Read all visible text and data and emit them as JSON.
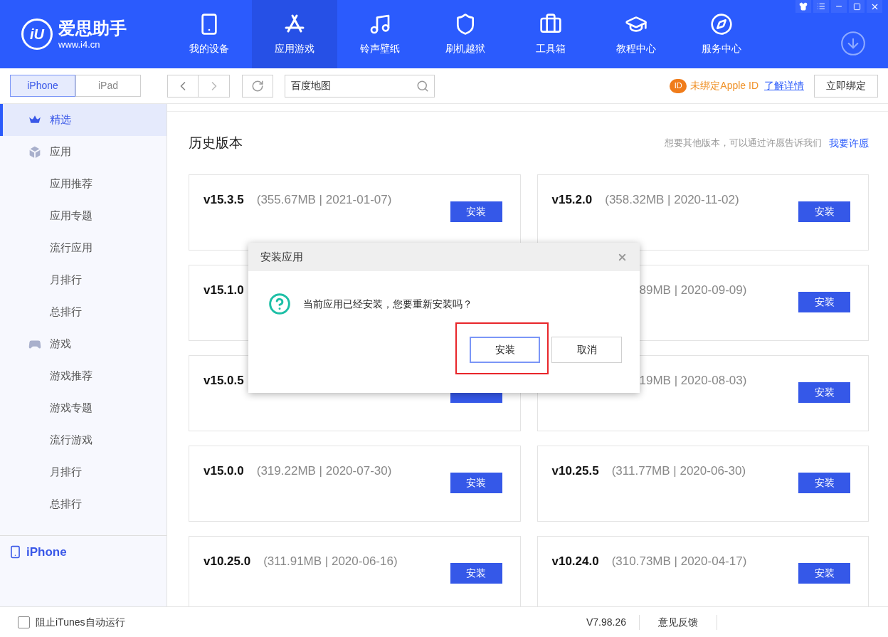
{
  "app": {
    "name": "爱思助手",
    "url": "www.i4.cn",
    "mark": "iU"
  },
  "nav": [
    {
      "label": "我的设备",
      "selected": false
    },
    {
      "label": "应用游戏",
      "selected": true
    },
    {
      "label": "铃声壁纸",
      "selected": false
    },
    {
      "label": "刷机越狱",
      "selected": false
    },
    {
      "label": "工具箱",
      "selected": false
    },
    {
      "label": "教程中心",
      "selected": false
    },
    {
      "label": "服务中心",
      "selected": false
    }
  ],
  "device_tabs": [
    {
      "label": "iPhone",
      "selected": true
    },
    {
      "label": "iPad",
      "selected": false
    }
  ],
  "search": {
    "value": "百度地图"
  },
  "apple_id": {
    "badge": "ID",
    "notice": "未绑定Apple ID",
    "link": "了解详情",
    "button": "立即绑定"
  },
  "sidebar": {
    "items": [
      {
        "label": "精选",
        "selected": true
      },
      {
        "label": "应用",
        "selected": false,
        "children": [
          {
            "label": "应用推荐",
            "selected": false
          },
          {
            "label": "应用专题",
            "selected": false
          },
          {
            "label": "流行应用",
            "selected": false
          },
          {
            "label": "月排行",
            "selected": false
          },
          {
            "label": "总排行",
            "selected": false
          }
        ]
      },
      {
        "label": "游戏",
        "selected": false,
        "children": [
          {
            "label": "游戏推荐",
            "selected": false
          },
          {
            "label": "游戏专题",
            "selected": false
          },
          {
            "label": "流行游戏",
            "selected": false
          },
          {
            "label": "月排行",
            "selected": false
          },
          {
            "label": "总排行",
            "selected": false
          }
        ]
      }
    ],
    "device": "iPhone"
  },
  "content": {
    "title": "历史版本",
    "hint": "想要其他版本，可以通过许愿告诉我们",
    "hint_link": "我要许愿",
    "cards": [
      {
        "version": "v15.3.5",
        "detail": "(355.67MB | 2021-01-07)",
        "button": "安装"
      },
      {
        "version": "v15.2.0",
        "detail": "(358.32MB | 2020-11-02)",
        "button": "安装"
      },
      {
        "version": "v15.1.0"
      },
      {
        "detail": "89MB | 2020-09-09)",
        "button": "安装"
      },
      {
        "version": "v15.0.5",
        "button_cut": true
      },
      {
        "detail": "19MB | 2020-08-03)",
        "button": "安装"
      },
      {
        "version": "v15.0.0",
        "detail": "(319.22MB | 2020-07-30)",
        "button": "安装"
      },
      {
        "version": "v10.25.5",
        "detail": "(311.77MB | 2020-06-30)",
        "button": "安装"
      },
      {
        "version": "v10.25.0",
        "detail": "(311.91MB | 2020-06-16)",
        "button": "安装"
      },
      {
        "version": "v10.24.0",
        "detail": "(310.73MB | 2020-04-17)",
        "button": "安装"
      }
    ]
  },
  "dialog": {
    "title": "安装应用",
    "message": "当前应用已经安装，您要重新安装吗？",
    "buttons": [
      {
        "label": "安装",
        "primary": true,
        "highlighted": true
      },
      {
        "label": "取消",
        "primary": false,
        "highlighted": false
      }
    ]
  },
  "status_bar": {
    "checkbox": {
      "label": "阻止iTunes自动运行",
      "checked": false
    },
    "version": "V7.98.26",
    "feedback": "意见反馈"
  }
}
